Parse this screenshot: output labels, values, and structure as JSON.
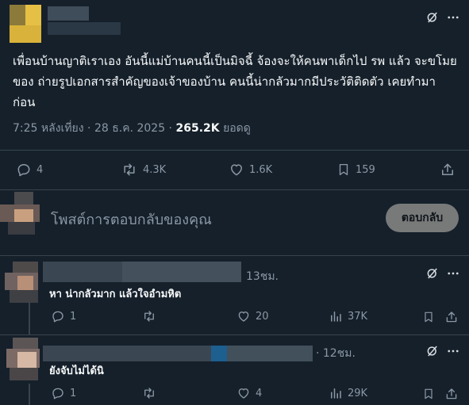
{
  "post": {
    "text": "เพื่อนบ้านญาติเราเอง อันนี้แม่บ้านคนนี้เป็นมิจฉี้ จ้องจะให้คนพาเด็กไป รพ แล้ว จะขโมยของ ถ่ายรูปเอกสารสำคัญของเจ้าของบ้าน คนนี้น่ากลัวมากมีประวัติติดตัว เคยทำมาก่อน",
    "time": "7:25 หลังเที่ยง",
    "date": "28 ธ.ค. 2025",
    "views": "265.2K",
    "views_label": "ยอดดู",
    "separator": " · ",
    "stats": {
      "replies": "4",
      "reposts": "4.3K",
      "likes": "1.6K",
      "bookmarks": "159"
    }
  },
  "compose": {
    "placeholder": "โพสต์การตอบกลับของคุณ",
    "button_label": "ตอบกลับ"
  },
  "replies": [
    {
      "time": "13ชม.",
      "text": "หา น่ากลัวมาก แล้วใจอำมหิต",
      "stats": {
        "replies": "1",
        "reposts": "",
        "likes": "20",
        "views": "37K"
      }
    },
    {
      "time": "· 12ชม.",
      "text": "ยังจับไม่ได้นิ",
      "stats": {
        "replies": "1",
        "reposts": "",
        "likes": "4",
        "views": "29K"
      }
    }
  ],
  "icons": {
    "grok": "grok-icon",
    "more": "more-icon",
    "reply": "reply-icon",
    "repost": "repost-icon",
    "like": "like-icon",
    "bookmark": "bookmark-icon",
    "share": "share-icon",
    "views": "views-icon"
  },
  "colors": {
    "background": "#15202b",
    "text": "#f7f9f9",
    "muted": "#8b98a5",
    "divider": "#38444d",
    "reply_button": "#787a7a"
  }
}
